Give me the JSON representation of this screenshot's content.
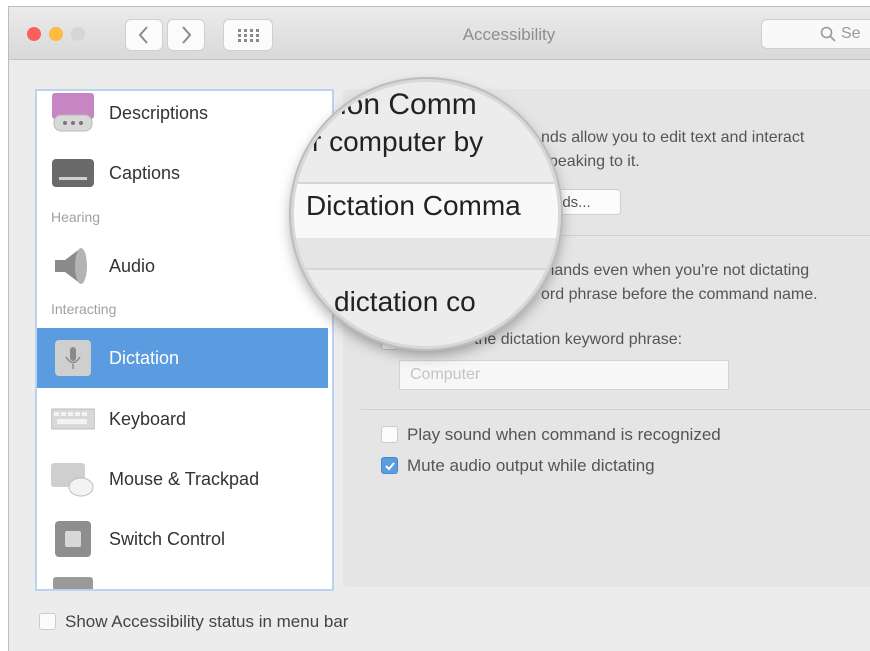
{
  "window": {
    "title": "Accessibility"
  },
  "toolbar": {
    "back_icon": "chevron-left-icon",
    "forward_icon": "chevron-right-icon",
    "grid_icon": "grid-icon"
  },
  "search": {
    "placeholder": "Se"
  },
  "sidebar": {
    "items": [
      {
        "label": "Descriptions",
        "icon": "speech-bubble-icon"
      },
      {
        "label": "Captions",
        "icon": "captions-icon"
      },
      {
        "label": "Audio",
        "icon": "speaker-icon"
      },
      {
        "label": "Dictation",
        "icon": "microphone-icon",
        "selected": true
      },
      {
        "label": "Keyboard",
        "icon": "keyboard-icon"
      },
      {
        "label": "Mouse & Trackpad",
        "icon": "mouse-icon"
      },
      {
        "label": "Switch Control",
        "icon": "switch-icon"
      }
    ],
    "sections": {
      "hearing": "Hearing",
      "interacting": "Interacting"
    }
  },
  "pane": {
    "desc_line1": "nds allow you to edit text and interact",
    "desc_line2": "speaking to it.",
    "button_partial": "nds...",
    "advanced_line1": "mands even when you're not dictating",
    "advanced_line2": "ord phrase before the command name.",
    "keyword_checkbox": "the dictation keyword phrase:",
    "keyword_placeholder": "Computer",
    "play_sound": "Play sound when command is recognized",
    "mute_audio": "Mute audio output while dictating"
  },
  "magnifier": {
    "line1": "ion Comm",
    "line2": "r computer by",
    "line3": "Dictation Comma",
    "line4": "dictation co"
  },
  "footer": {
    "status_menu_label": "Show Accessibility status in menu bar"
  },
  "colors": {
    "accent": "#5b9be0",
    "selected_bg": "#5b9be0"
  },
  "state": {
    "play_sound_checked": false,
    "mute_audio_checked": true,
    "status_menu_checked": false,
    "keyword_checked": false
  }
}
